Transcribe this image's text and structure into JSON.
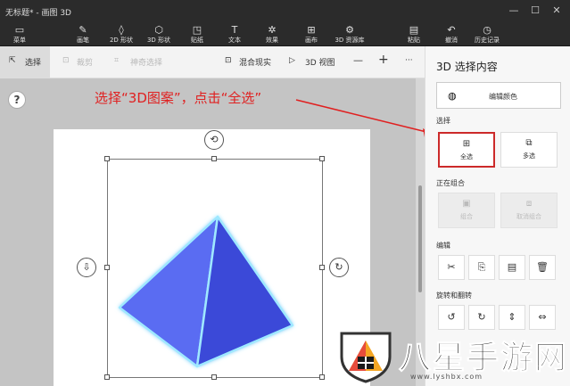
{
  "window": {
    "title": "无标题* - 画图 3D",
    "controls": [
      "—",
      "☐",
      "✕"
    ]
  },
  "ribbon": {
    "items": [
      {
        "label": "菜单",
        "icon": "folder-icon"
      },
      {
        "label": "画笔",
        "icon": "brush-icon"
      },
      {
        "label": "2D 形状",
        "icon": "2d-shapes-icon"
      },
      {
        "label": "3D 形状",
        "icon": "3d-shapes-icon"
      },
      {
        "label": "贴纸",
        "icon": "sticker-icon"
      },
      {
        "label": "文本",
        "icon": "text-icon"
      },
      {
        "label": "效果",
        "icon": "effects-icon"
      },
      {
        "label": "画布",
        "icon": "canvas-icon"
      },
      {
        "label": "3D 资源库",
        "icon": "3d-library-icon"
      },
      {
        "label": "粘贴",
        "icon": "paste-icon"
      },
      {
        "label": "撤消",
        "icon": "undo-icon"
      },
      {
        "label": "历史记录",
        "icon": "history-icon"
      }
    ]
  },
  "toolbar": {
    "select": "选择",
    "crop": "裁剪",
    "magic_select": "神奇选择",
    "mixed_reality": "混合现实",
    "view_3d": "3D 视图",
    "zoom_out": "—",
    "zoom_in": "+",
    "more": "···"
  },
  "canvas": {
    "help": "?",
    "annotation": "选择“3D图案”，点击“全选”"
  },
  "panel": {
    "title": "3D 选择内容",
    "edit_color": "编辑颜色",
    "section_select": "选择",
    "select_all": "全选",
    "multi_select": "多选",
    "section_grouping": "正在组合",
    "group": "组合",
    "ungroup": "取消组合",
    "section_edit": "编辑",
    "section_rotate": "旋转和翻转"
  },
  "watermark": {
    "text": "八星手游网",
    "url": "www.lyshbx.com"
  },
  "colors": {
    "annotation": "#e02020",
    "pyramid_light": "#5a6cf2",
    "pyramid_dark": "#3a48d8",
    "active_border": "#cc2a2a"
  }
}
